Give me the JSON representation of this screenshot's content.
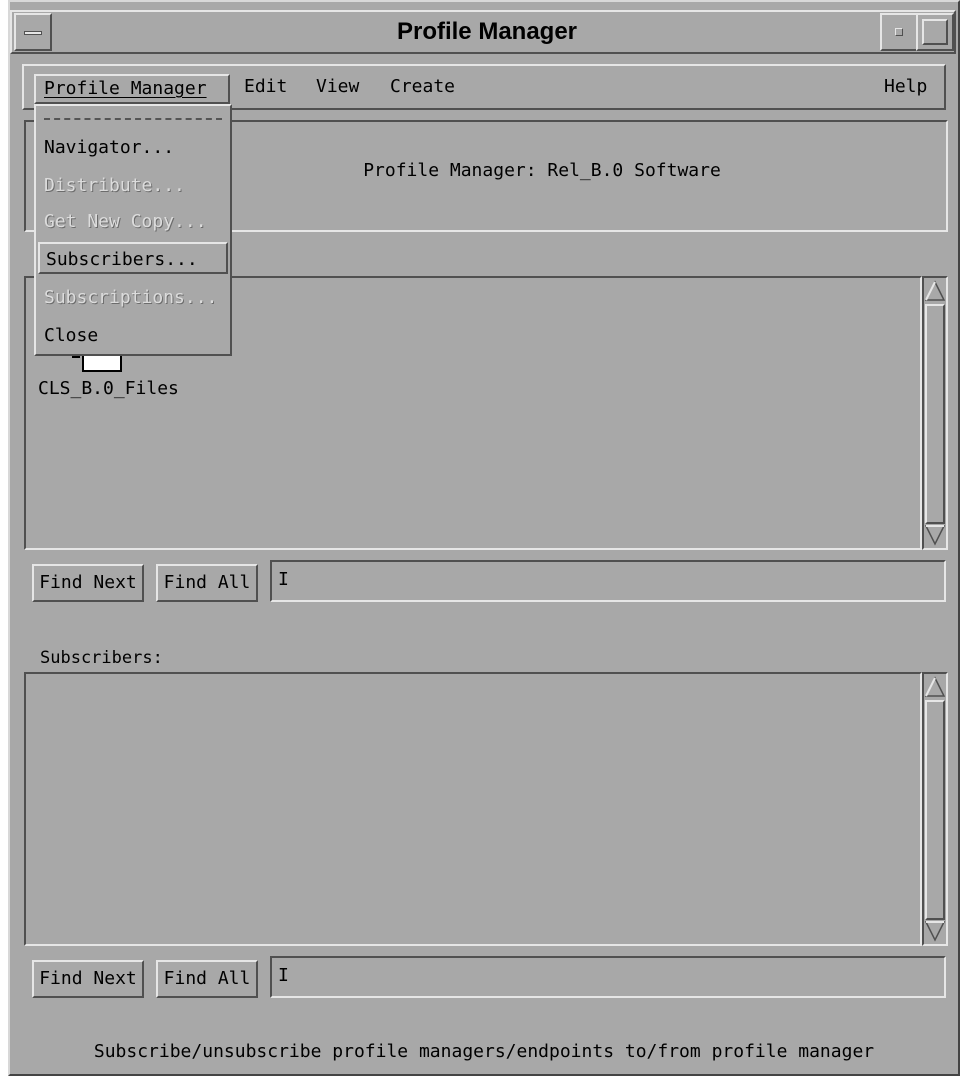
{
  "window": {
    "title": "Profile Manager"
  },
  "menubar": {
    "items": [
      {
        "label": "Profile Manager"
      },
      {
        "label": "Edit"
      },
      {
        "label": "View"
      },
      {
        "label": "Create"
      }
    ],
    "help_label": "Help"
  },
  "dropdown": {
    "items": [
      {
        "label": "Navigator...",
        "enabled": true
      },
      {
        "label": "Distribute...",
        "enabled": false
      },
      {
        "label": "Get New Copy...",
        "enabled": false
      },
      {
        "label": "Subscribers...",
        "enabled": true,
        "selected": true
      },
      {
        "label": "Subscriptions...",
        "enabled": false
      },
      {
        "label": "Close",
        "enabled": true
      }
    ]
  },
  "header": {
    "label": "Profile Manager: Rel_B.0 Software"
  },
  "profiles": {
    "items": [
      {
        "name": "CLS_B.0_Files",
        "icon": "file-profile-icon"
      }
    ],
    "find_next_label": "Find Next",
    "find_all_label": "Find All",
    "search_value": ""
  },
  "subscribers": {
    "heading": "Subscribers:",
    "items": [],
    "find_next_label": "Find Next",
    "find_all_label": "Find All",
    "search_value": ""
  },
  "status_text": "Subscribe/unsubscribe profile managers/endpoints to/from profile manager",
  "colors": {
    "background": "#a8a8a8",
    "disabled_text": "#dcdcdc"
  }
}
